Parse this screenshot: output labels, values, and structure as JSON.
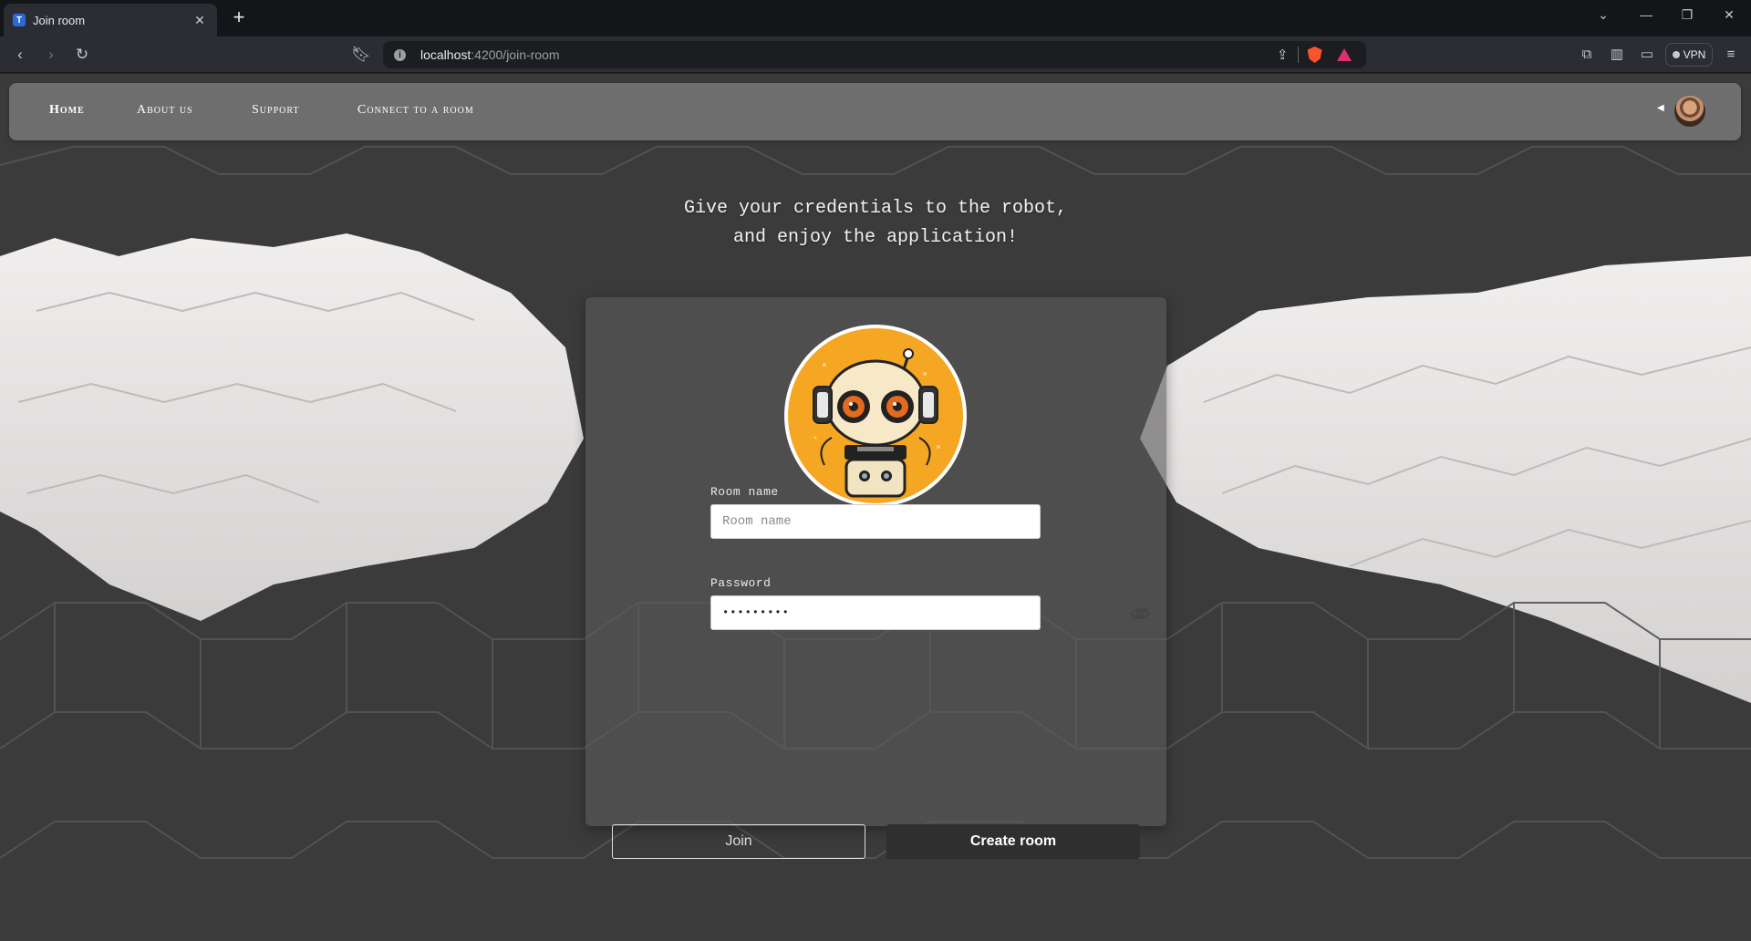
{
  "browser": {
    "tab_title": "Join room",
    "tab_favicon": "T",
    "url_host": "localhost",
    "url_path": ":4200/join-room",
    "vpn_label": "VPN",
    "accent": "#2a6bd6"
  },
  "nav": {
    "links": [
      "Home",
      "About us",
      "Support",
      "Connect to a room"
    ],
    "active": "Home"
  },
  "headline": {
    "line1": "Give your credentials to the robot,",
    "line2": "and enjoy the application!"
  },
  "form": {
    "room_label": "Room name",
    "room_placeholder": "Room name",
    "room_value": "",
    "password_label": "Password",
    "password_value": "•••••••••",
    "join_label": "Join",
    "create_label": "Create room"
  },
  "icons": {
    "back": "back-arrow-icon",
    "forward": "forward-arrow-icon",
    "reload": "reload-icon",
    "bookmark": "bookmark-icon",
    "share": "share-icon",
    "brave": "brave-shield-icon",
    "rewards": "brave-rewards-icon",
    "extensions": "extensions-icon",
    "sidebar": "sidebar-icon",
    "wallet": "wallet-icon",
    "menu": "menu-icon",
    "eye": "eye-slash-icon"
  }
}
